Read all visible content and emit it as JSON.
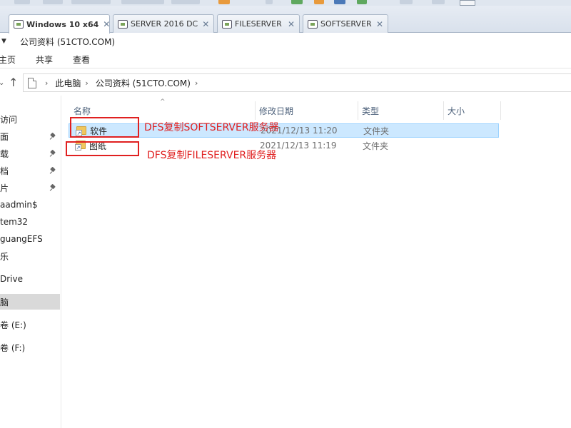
{
  "vm_tabs": [
    {
      "label": "Windows 10 x64",
      "active": true
    },
    {
      "label": "SERVER 2016 DC",
      "active": false
    },
    {
      "label": "FILESERVER",
      "active": false
    },
    {
      "label": "SOFTSERVER",
      "active": false
    }
  ],
  "tab_close_glyph": "✕",
  "window_title": "公司资料 (51CTO.COM)",
  "ribbon_tabs": [
    "主页",
    "共享",
    "查看"
  ],
  "breadcrumb": [
    "此电脑",
    "公司资料 (51CTO.COM)"
  ],
  "nav_items": [
    "访问",
    "面",
    "载",
    "档",
    "片",
    "aadmin$",
    "tem32",
    "guangEFS",
    "乐",
    "Drive",
    "脑",
    "卷 (E:)",
    "卷 (F:)"
  ],
  "columns": {
    "name": "名称",
    "date": "修改日期",
    "type": "类型",
    "size": "大小"
  },
  "files": [
    {
      "name": "软件",
      "date": "2021/12/13 11:20",
      "type": "文件夹",
      "selected": true
    },
    {
      "name": "图纸",
      "date": "2021/12/13 11:19",
      "type": "文件夹",
      "selected": false
    }
  ],
  "annotations": [
    "DFS复制SOFTSERVER服务器",
    "DFS复制FILESERVER服务器"
  ],
  "colors": {
    "annotation": "#e02020",
    "selection": "#cce8ff"
  }
}
